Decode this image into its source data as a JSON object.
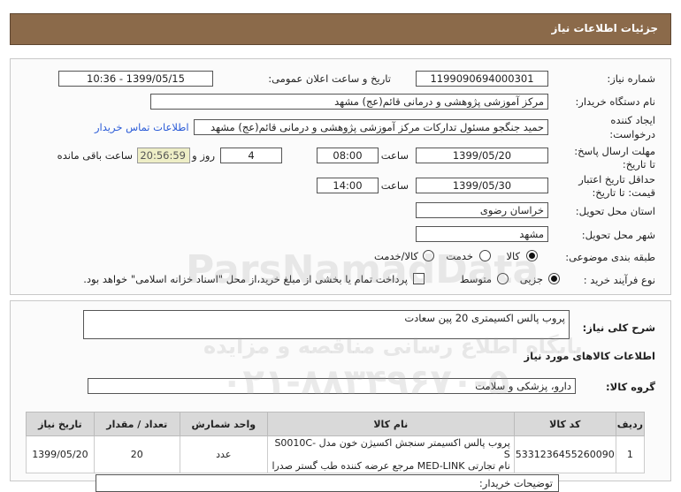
{
  "header": {
    "title": "جزئیات اطلاعات نیاز"
  },
  "form": {
    "need_number_label": "شماره نیاز:",
    "need_number": "1199090694000301",
    "announce_label": "تاریخ و ساعت اعلان عمومی:",
    "announce_value": "1399/05/15 - 10:36",
    "buyer_org_label": "نام دستگاه خریدار:",
    "buyer_org": "مرکز آموزشی پژوهشی و درمانی قائم(عج) مشهد",
    "creator_label_1": "ایجاد کننده",
    "creator_label_2": "درخواست:",
    "creator": "حمید جنگجو مسئول تدارکات مرکز آموزشی پژوهشی و درمانی قائم(عج) مشهد",
    "contact_link": "اطلاعات تماس خریدار",
    "send_deadline_label_1": "مهلت ارسال پاسخ:",
    "send_deadline_label_2": "تا تاریخ:",
    "send_date": "1399/05/20",
    "time_label": "ساعت",
    "send_time": "08:00",
    "days_value": "4",
    "days_label": "روز و",
    "remaining_time": "20:56:59",
    "remaining_label": "ساعت باقی مانده",
    "validity_label_1": "حداقل تاریخ اعتبار",
    "validity_label_2": "قیمت: تا تاریخ:",
    "validity_date": "1399/05/30",
    "validity_time": "14:00",
    "province_label": "استان محل تحویل:",
    "province": "خراسان رضوی",
    "city_label": "شهر محل تحویل:",
    "city": "مشهد",
    "category_label": "طبقه بندی موضوعی:",
    "category_options": [
      "کالا",
      "خدمت",
      "کالا/خدمت"
    ],
    "category_selected": "کالا",
    "purchase_type_label": "نوع فرآیند خرید :",
    "purchase_options": [
      "جزیی",
      "متوسط"
    ],
    "purchase_selected": "جزیی",
    "payment_note": "پرداخت تمام یا بخشی از مبلغ خرید،از محل \"اسناد خزانه اسلامی\" خواهد بود."
  },
  "description": {
    "label": "شرح کلی نیاز:",
    "value": "پروب پالس اکسیمتری 20 پین سعادت"
  },
  "goods": {
    "section_title": "اطلاعات کالاهای مورد نیاز",
    "group_label": "گروه کالا:",
    "group_value": "دارو، پزشکی و سلامت",
    "columns": [
      "ردیف",
      "کد کالا",
      "نام کالا",
      "واحد شمارش",
      "تعداد / مقدار",
      "تاریخ نیاز"
    ],
    "rows": [
      {
        "index": "1",
        "code": "5331236455260090",
        "name_line1": "پروب پالس اکسیمتر سنجش اکسیژن خون مدل S0010C-S",
        "name_line2": "نام تجارتی MED-LINK مرجع عرضه کننده طب گستر صدرا",
        "unit": "عدد",
        "quantity": "20",
        "date": "1399/05/20"
      }
    ]
  },
  "footer": {
    "buyer_notes_label": "توضیحات خریدار:"
  },
  "watermark": {
    "brand": "ParsNamadData",
    "line1": "پایگاه اطلاع رسانی مناقصه و مزایده",
    "phone": "۰۲۱-۸۸۳۴۹۶۷۰-۵"
  }
}
